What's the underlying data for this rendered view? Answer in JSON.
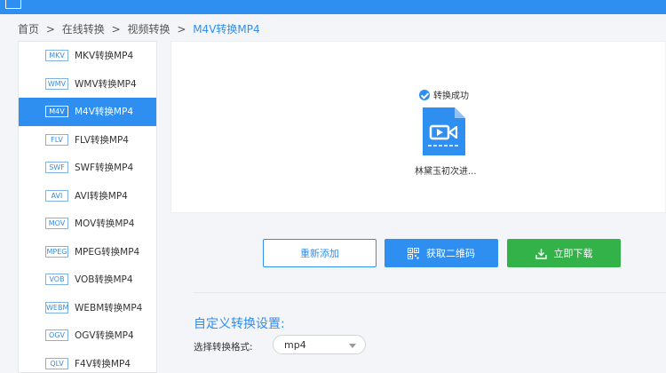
{
  "breadcrumb": {
    "items": [
      "首页",
      ">",
      "在线转换",
      ">",
      "视频转换",
      ">"
    ],
    "current": "M4V转换MP4"
  },
  "sidebar": {
    "items": [
      {
        "badge": "MKV",
        "label": "MKV转换MP4",
        "active": false
      },
      {
        "badge": "WMV",
        "label": "WMV转换MP4",
        "active": false
      },
      {
        "badge": "M4V",
        "label": "M4V转换MP4",
        "active": true
      },
      {
        "badge": "FLV",
        "label": "FLV转换MP4",
        "active": false
      },
      {
        "badge": "SWF",
        "label": "SWF转换MP4",
        "active": false
      },
      {
        "badge": "AVI",
        "label": "AVI转换MP4",
        "active": false
      },
      {
        "badge": "MOV",
        "label": "MOV转换MP4",
        "active": false
      },
      {
        "badge": "MPEG",
        "label": "MPEG转换MP4",
        "active": false
      },
      {
        "badge": "VOB",
        "label": "VOB转换MP4",
        "active": false
      },
      {
        "badge": "WEBM",
        "label": "WEBM转换MP4",
        "active": false
      },
      {
        "badge": "OGV",
        "label": "OGV转换MP4",
        "active": false
      },
      {
        "badge": "QLV",
        "label": "F4V转换MP4",
        "active": false
      }
    ]
  },
  "result": {
    "status": "转换成功",
    "file_name": "林黛玉初次进..."
  },
  "buttons": {
    "re_add": "重新添加",
    "qr": "获取二维码",
    "download": "立即下载"
  },
  "settings": {
    "title": "自定义转换设置:",
    "format_label": "选择转换格式:",
    "format_value": "mp4"
  },
  "colors": {
    "accent": "#2f8ff0",
    "download": "#33b24a"
  }
}
